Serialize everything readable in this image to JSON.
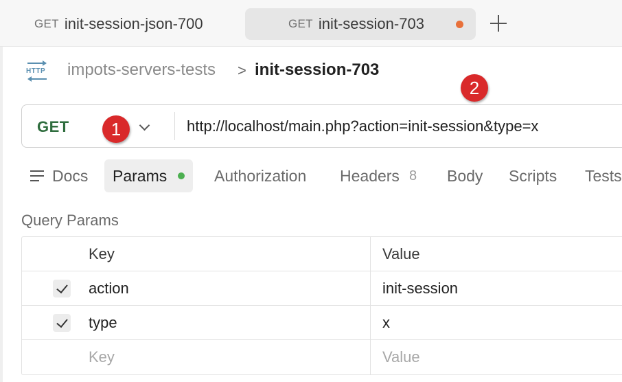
{
  "tabs": [
    {
      "method": "GET",
      "name": "init-session-json-700"
    },
    {
      "method": "GET",
      "name": "init-session-703",
      "modified": true
    }
  ],
  "breadcrumb": {
    "collection": "impots-servers-tests",
    "separator": ">",
    "request": "init-session-703",
    "icon": "http-icon"
  },
  "annotations": {
    "badge1": "1",
    "badge2": "2"
  },
  "request": {
    "method": "GET",
    "url": "http://localhost/main.php?action=init-session&type=x"
  },
  "request_tabs": [
    {
      "label": "Docs"
    },
    {
      "label": "Params",
      "active": true
    },
    {
      "label": "Authorization"
    },
    {
      "label": "Headers",
      "count": "8"
    },
    {
      "label": "Body"
    },
    {
      "label": "Scripts"
    },
    {
      "label": "Tests"
    }
  ],
  "query_params": {
    "title": "Query Params",
    "headers": {
      "key": "Key",
      "value": "Value"
    },
    "rows": [
      {
        "key": "action",
        "value": "init-session",
        "checked": true
      },
      {
        "key": "type",
        "value": "x",
        "checked": true
      }
    ],
    "placeholder": {
      "key": "Key",
      "value": "Value"
    }
  },
  "colors": {
    "method_get": "#2f6d3e",
    "unsaved_dot": "#e8703a",
    "params_dot": "#4caf50",
    "badge": "#d9292a"
  }
}
